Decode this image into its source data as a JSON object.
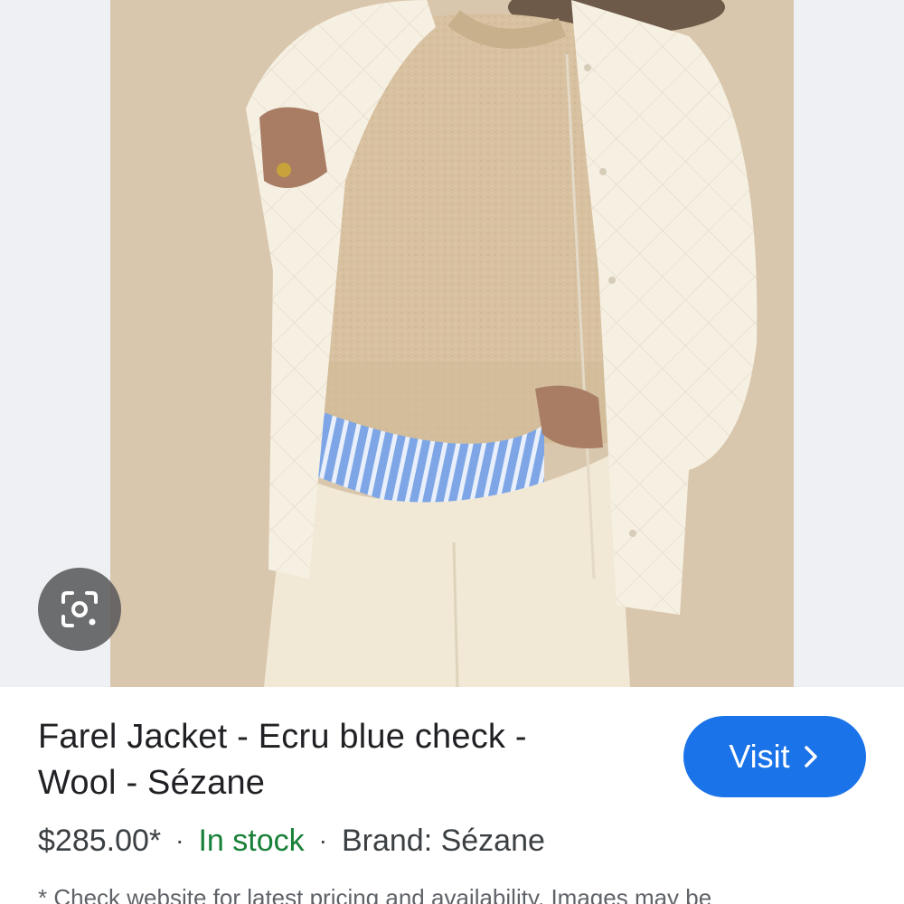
{
  "product": {
    "image_alt": "Model wearing ecru quilted jacket over beige wool sweater and blue striped shirt",
    "title_line1": "Farel Jacket - Ecru blue check -",
    "title_line2": "Wool - Sézane",
    "price": "$285.00*",
    "separator": "·",
    "availability": "In stock",
    "brand": "Brand: Sézane",
    "disclaimer": "* Check website for latest pricing and availability. Images may be"
  },
  "actions": {
    "visit_label": "Visit",
    "visit_icon": "chevron-right-icon",
    "lens_icon": "google-lens-icon"
  },
  "colors": {
    "visit_button": "#1a73e8",
    "in_stock": "#188038",
    "title_text": "#202124",
    "secondary_text": "#5f6368",
    "image_background": "#d9c7ad"
  }
}
